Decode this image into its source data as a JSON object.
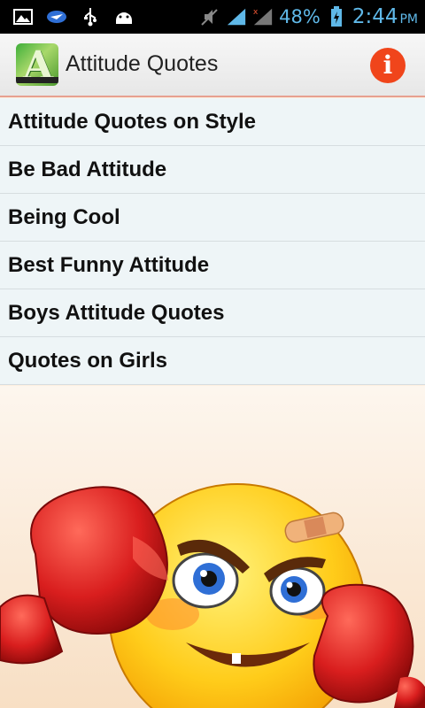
{
  "status_bar": {
    "battery": "48%",
    "time": "2:44",
    "ampm": "PM"
  },
  "action_bar": {
    "title": "Attitude Quotes",
    "info_glyph": "i",
    "app_icon_letter": "A"
  },
  "list": {
    "items": [
      {
        "label": "Attitude Quotes on Style"
      },
      {
        "label": "Be Bad Attitude"
      },
      {
        "label": "Being Cool"
      },
      {
        "label": "Best Funny Attitude"
      },
      {
        "label": "Boys Attitude Quotes"
      },
      {
        "label": "Quotes on Girls"
      }
    ]
  },
  "colors": {
    "status_icon_blue": "#5fb8e8",
    "info_orange": "#f0451b",
    "list_bg": "#eef5f7"
  },
  "icons": [
    "gallery-icon",
    "messaging-icon",
    "usb-icon",
    "android-icon",
    "mute-icon",
    "signal-icon",
    "no-signal-icon",
    "battery-charging-icon",
    "info-icon"
  ]
}
